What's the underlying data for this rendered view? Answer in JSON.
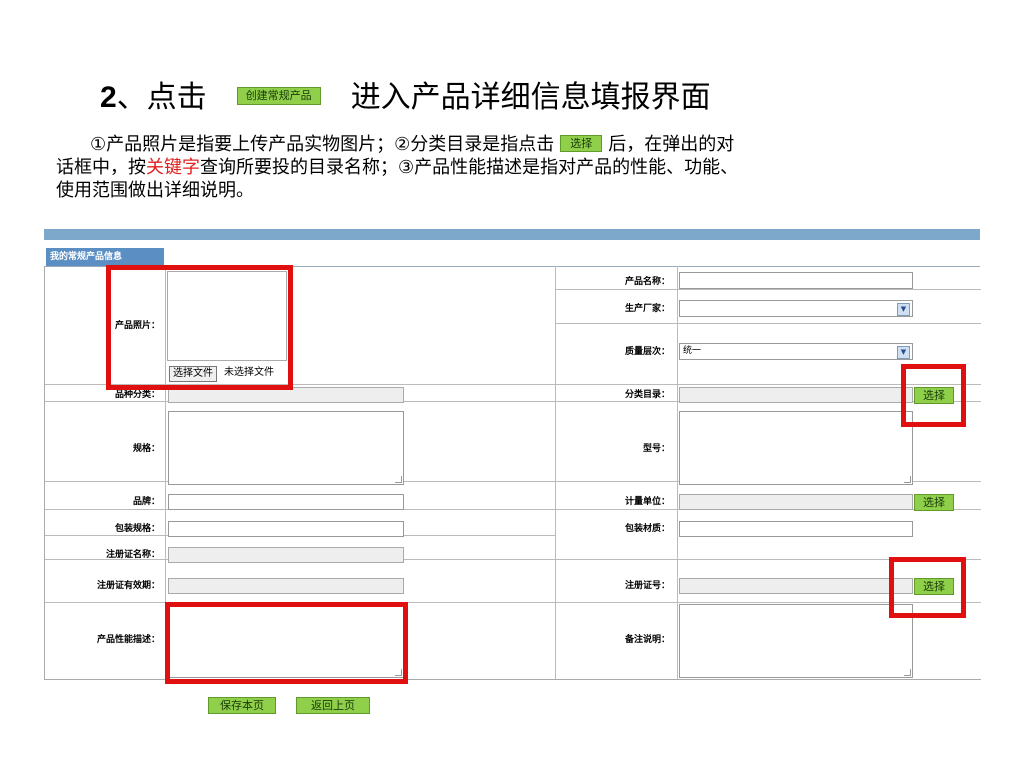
{
  "title": {
    "number": "2",
    "prefix": "、点击",
    "button_label": "创建常规产品",
    "suffix": "进入产品详细信息填报界面"
  },
  "paragraph": {
    "p1": "①产品照片是指要上传产品实物图片；②分类目录是指点击",
    "select_label": "选择",
    "p2": "后，在弹出的对",
    "p3": "话框中，按",
    "keyword": "关键字",
    "p4": "查询所要投的目录名称；③产品性能描述是指对产品的性能、功能、",
    "p5": "使用范围做出详细说明。"
  },
  "form": {
    "tab_label": "我的常规产品信息",
    "labels": {
      "photo": "产品照片：",
      "product_name": "产品名称：",
      "manufacturer": "生产厂家：",
      "quality_level": "质量层次：",
      "variety_category": "品种分类：",
      "category_catalog": "分类目录：",
      "spec": "规格：",
      "model": "型号：",
      "brand": "品牌：",
      "unit": "计量单位：",
      "pack_spec": "包装规格：",
      "pack_material": "包装材质：",
      "reg_name": "注册证名称：",
      "reg_validity": "注册证有效期：",
      "reg_number": "注册证号：",
      "performance": "产品性能描述：",
      "remarks": "备注说明："
    },
    "file_button": "选择文件",
    "file_status": "未选择文件",
    "quality_value": "统一",
    "select_button": "选择",
    "save_button": "保存本页",
    "back_button": "返回上页"
  },
  "colors": {
    "accent_green": "#8fcf4a",
    "highlight_red": "#e01010",
    "header_blue": "#7ea7cc"
  }
}
